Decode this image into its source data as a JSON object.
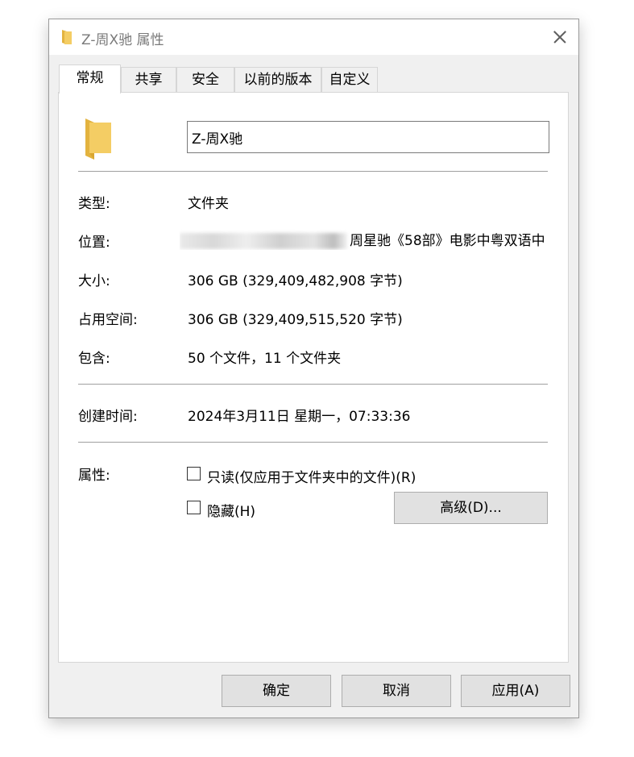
{
  "window": {
    "title": "Z-周X驰 属性",
    "icon": "folder-icon"
  },
  "tabs": [
    {
      "label": "常规",
      "active": true
    },
    {
      "label": "共享",
      "active": false
    },
    {
      "label": "安全",
      "active": false
    },
    {
      "label": "以前的版本",
      "active": false
    },
    {
      "label": "自定义",
      "active": false
    }
  ],
  "general": {
    "folder_name": "Z-周X驰",
    "type_label": "类型:",
    "type_value": "文件夹",
    "location_label": "位置:",
    "location_value": "周星驰《58部》电影中粤双语中",
    "size_label": "大小:",
    "size_value": "306 GB (329,409,482,908 字节)",
    "disk_size_label": "占用空间:",
    "disk_size_value": "306 GB (329,409,515,520 字节)",
    "contains_label": "包含:",
    "contains_value": "50 个文件，11 个文件夹",
    "created_label": "创建时间:",
    "created_value": "2024年3月11日 星期一，07:33:36",
    "attributes_label": "属性:",
    "readonly_label": "只读(仅应用于文件夹中的文件)(R)",
    "readonly_checked": false,
    "hidden_label": "隐藏(H)",
    "hidden_checked": false,
    "advanced_button": "高级(D)..."
  },
  "footer": {
    "ok": "确定",
    "cancel": "取消",
    "apply": "应用(A)"
  },
  "colors": {
    "window_bg": "#f0f0f0",
    "panel_bg": "#ffffff",
    "folder_yellow": "#f4cd64",
    "button_bg": "#e1e1e1"
  }
}
